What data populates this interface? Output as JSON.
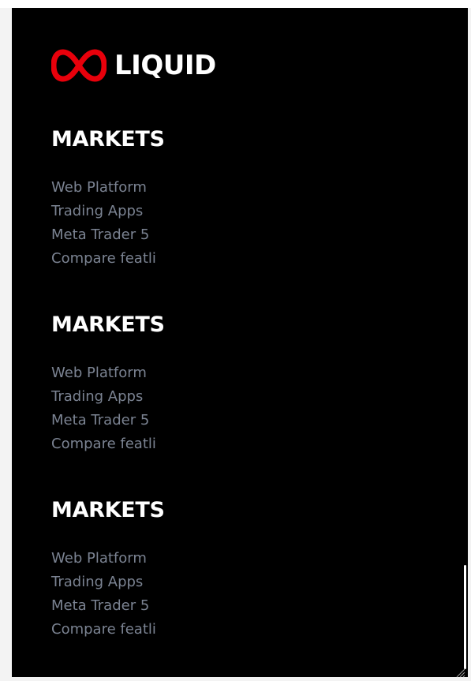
{
  "brand": {
    "name": "LIQUID",
    "logo_icon": "infinity-icon",
    "logo_color": "#e8000b"
  },
  "footer_sections": [
    {
      "heading": "MARKETS",
      "links": [
        "Web Platform",
        "Trading Apps",
        "Meta Trader 5",
        "Compare featli"
      ]
    },
    {
      "heading": "MARKETS",
      "links": [
        "Web Platform",
        "Trading Apps",
        "Meta Trader 5",
        "Compare featli"
      ]
    },
    {
      "heading": "MARKETS",
      "links": [
        "Web Platform",
        "Trading Apps",
        "Meta Trader 5",
        "Compare featli"
      ]
    }
  ],
  "colors": {
    "background": "#000000",
    "heading": "#ffffff",
    "link": "#7b8392"
  }
}
